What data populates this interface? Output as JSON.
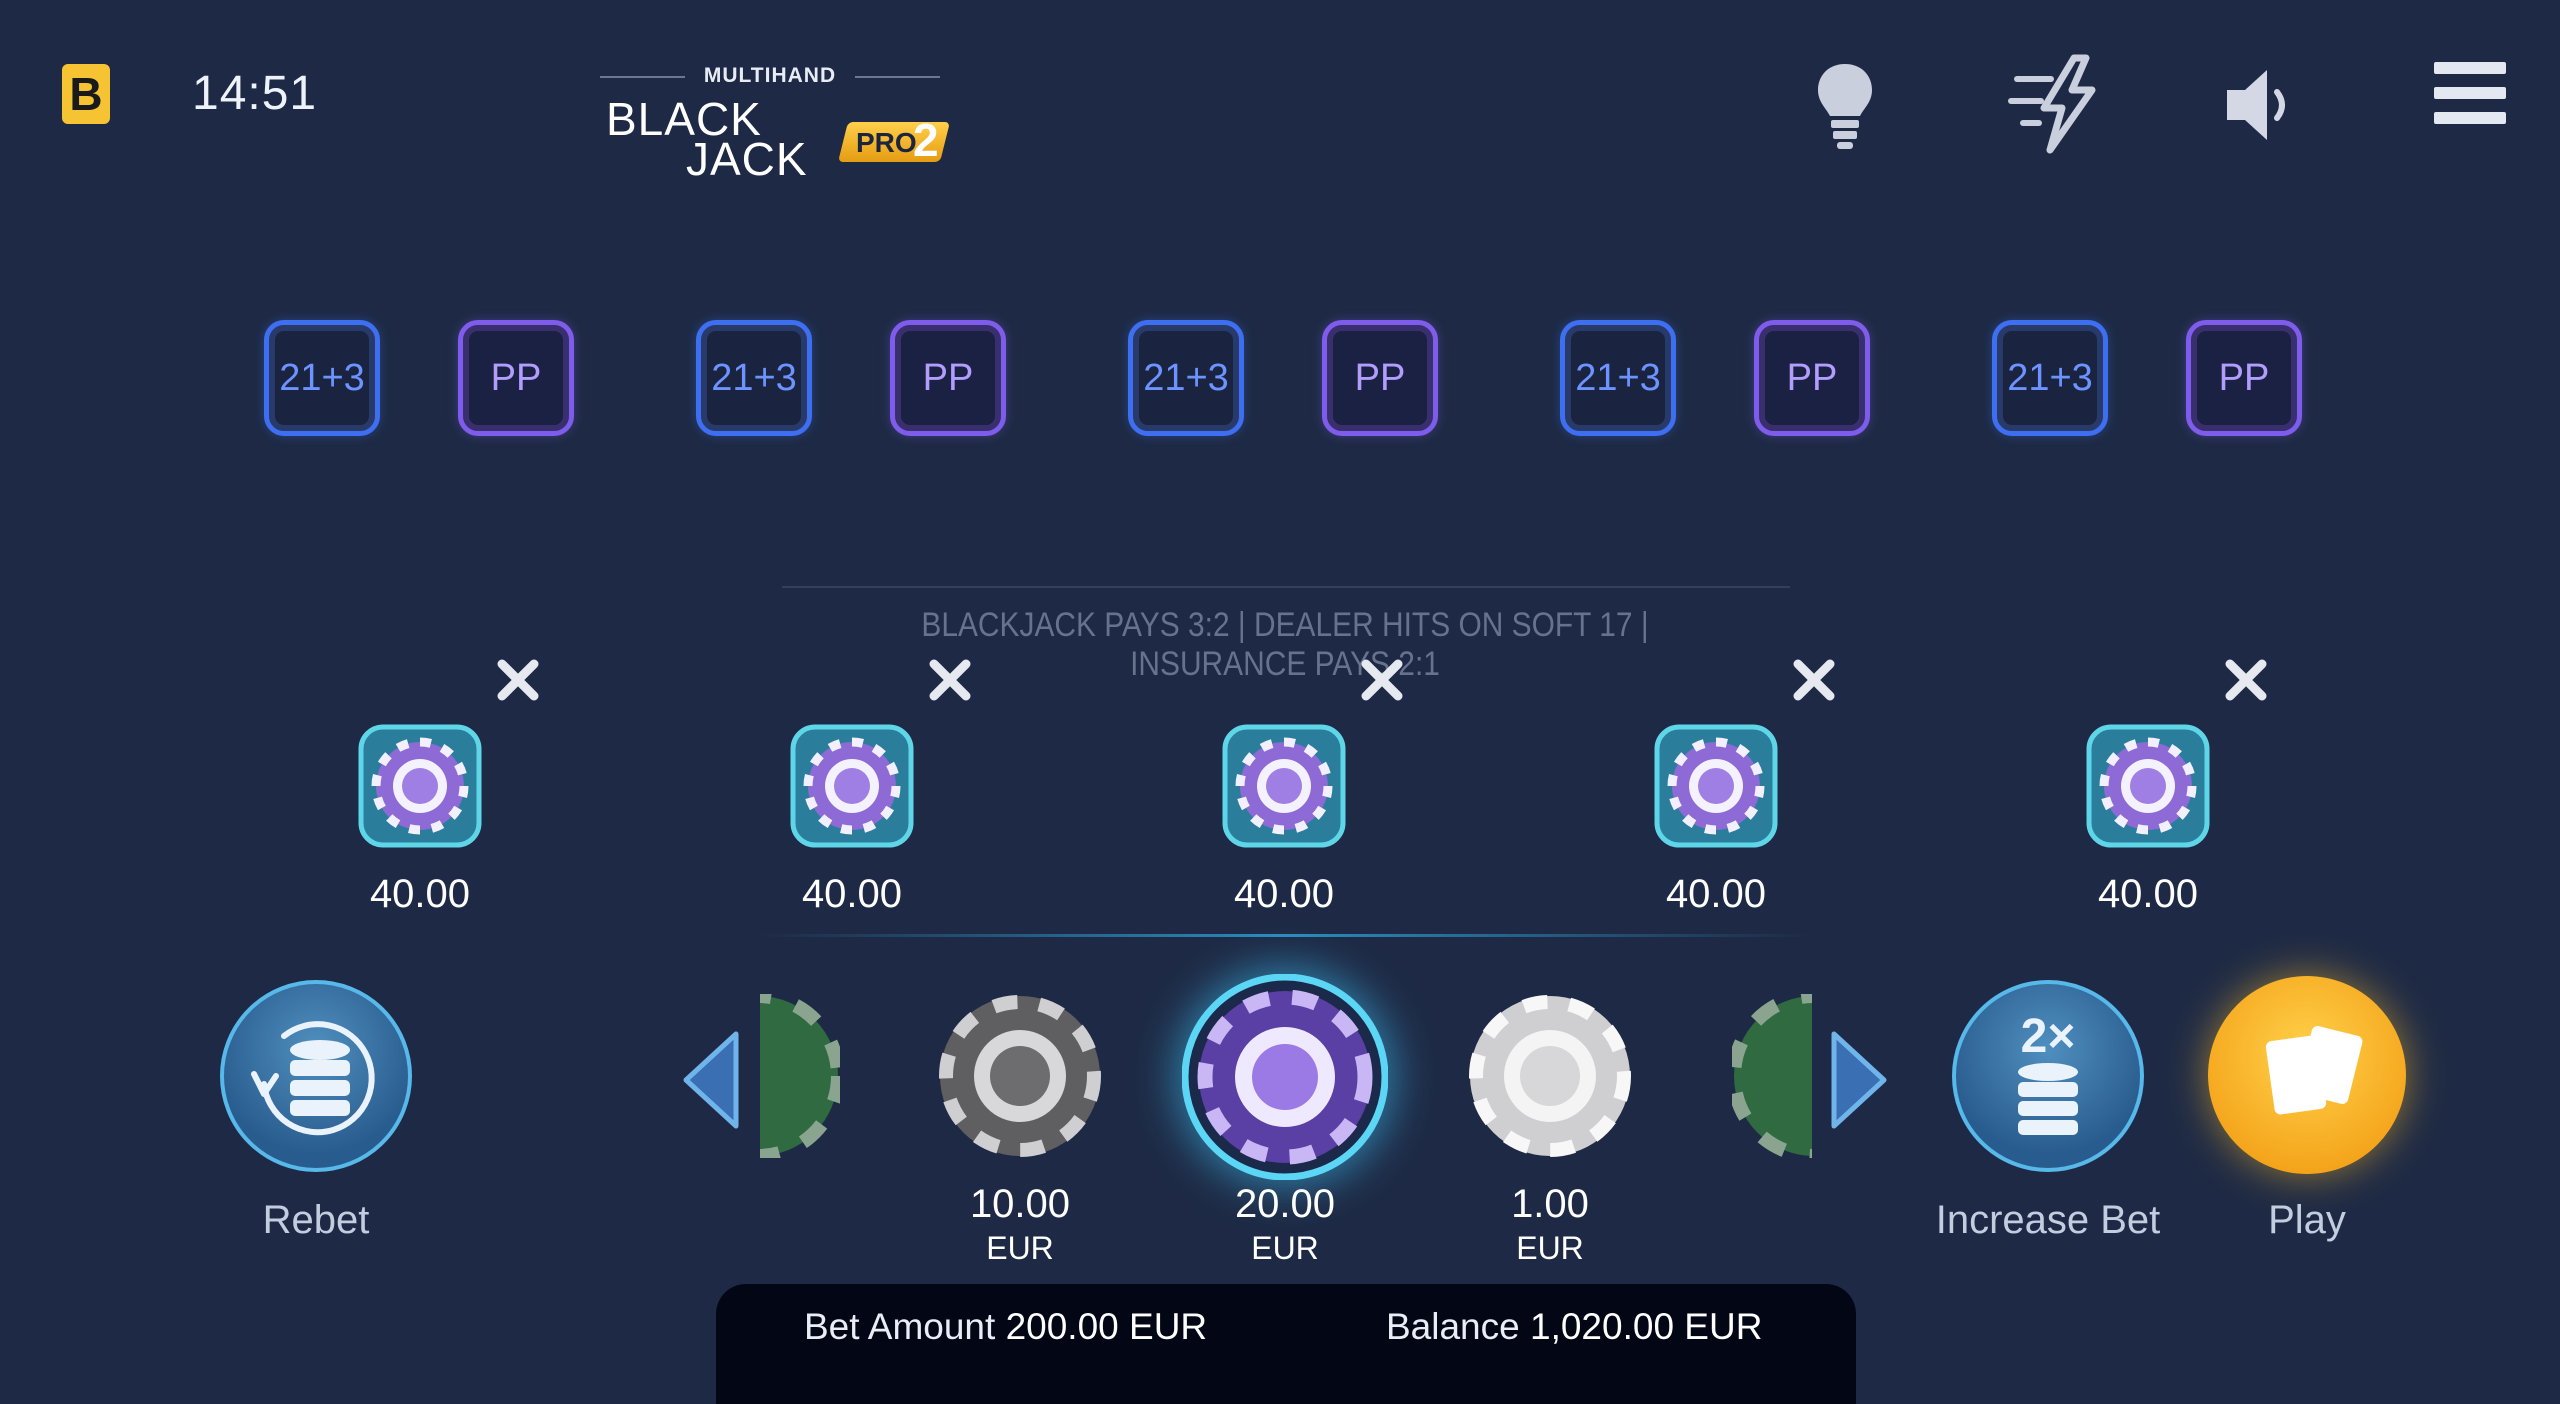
{
  "header": {
    "brand_letter": "B",
    "clock": "14:51",
    "logo": {
      "line1": "MULTIHAND",
      "line2": "BLACK",
      "line3": "JACK",
      "badge": "PRO",
      "badge_num": "2"
    },
    "icons": [
      "lightbulb-icon",
      "lightning-speed-icon",
      "speaker-icon",
      "hamburger-menu-icon"
    ]
  },
  "side_bets": [
    {
      "a": "21+3",
      "b": "PP"
    },
    {
      "a": "21+3",
      "b": "PP"
    },
    {
      "a": "21+3",
      "b": "PP"
    },
    {
      "a": "21+3",
      "b": "PP"
    },
    {
      "a": "21+3",
      "b": "PP"
    }
  ],
  "rules_text": "BLACKJACK PAYS 3:2 | DEALER HITS ON SOFT 17 | INSURANCE PAYS 2:1",
  "hands": [
    {
      "amount": "40.00"
    },
    {
      "amount": "40.00"
    },
    {
      "amount": "40.00"
    },
    {
      "amount": "40.00"
    },
    {
      "amount": "40.00"
    }
  ],
  "controls": {
    "rebet": "Rebet",
    "increase": "Increase Bet",
    "increase_badge": "2×",
    "play": "Play"
  },
  "chips": [
    {
      "amount": "10.00",
      "currency": "EUR",
      "color": "#8e8e8e"
    },
    {
      "amount": "20.00",
      "currency": "EUR",
      "color": "#8b65d8",
      "selected": true
    },
    {
      "amount": "1.00",
      "currency": "EUR",
      "color": "#e8e8e8"
    }
  ],
  "footer": {
    "bet_label": "Bet Amount",
    "bet_value": "200.00 EUR",
    "balance_label": "Balance",
    "balance_value": "1,020.00 EUR"
  },
  "colors": {
    "background": "#1e2a45",
    "accent_blue": "#3d6ff0",
    "accent_purple": "#7e5cec",
    "play": "#f4a41b"
  }
}
